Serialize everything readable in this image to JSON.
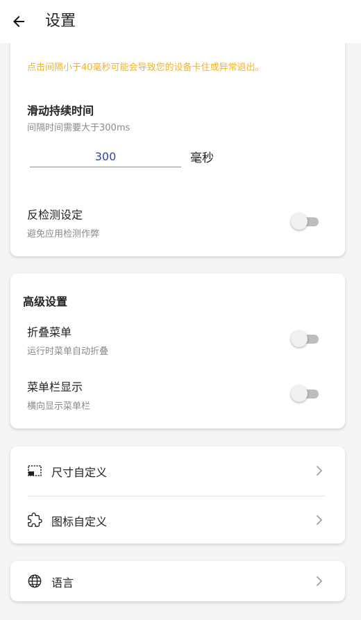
{
  "header": {
    "title": "设置"
  },
  "settings_card": {
    "warning": "点击间隔小于40毫秒可能会导致您的设备卡住或异常退出。",
    "swipe_duration": {
      "title": "滑动持续时间",
      "subtitle": "间隔时间需要大于300ms",
      "value": "300",
      "unit": "毫秒"
    },
    "anti_detection": {
      "title": "反检测设定",
      "subtitle": "避免应用检测作弊",
      "enabled": false
    }
  },
  "advanced": {
    "title": "高级设置",
    "collapse_menu": {
      "title": "折叠菜单",
      "subtitle": "运行时菜单自动折叠",
      "enabled": false
    },
    "menu_bar": {
      "title": "菜单栏显示",
      "subtitle": "横向显示菜单栏",
      "enabled": false
    }
  },
  "customize": {
    "size_label": "尺寸自定义",
    "icon_label": "图标自定义"
  },
  "language": {
    "label": "语言"
  },
  "colors": {
    "warning": "#f0b429",
    "input_text": "#3346a5",
    "toggle_track_off": "#bdbdbd",
    "toggle_knob_off": "#f1f1f1"
  }
}
